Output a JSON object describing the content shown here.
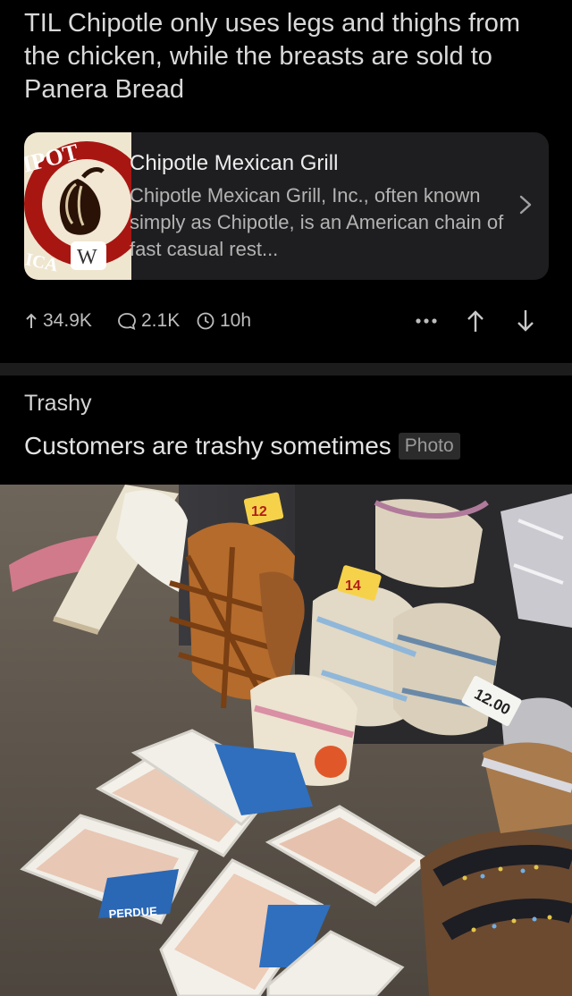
{
  "post1": {
    "title": "TIL Chipotle only uses legs and thighs from the chicken, while the breasts are sold to Panera Bread",
    "link_card": {
      "thumb_text_top": "IPOT",
      "thumb_text_bottom": "ICA",
      "wiki_badge": "W",
      "title": "Chipotle Mexican Grill",
      "description": "Chipotle Mexican Grill, Inc., often known simply as Chipotle, is an American chain of fast casual rest...",
      "chevron_icon": "chevron-right-icon",
      "brand_color": "#a81612"
    },
    "stats": {
      "upvotes": "34.9K",
      "comments": "2.1K",
      "age": "10h"
    }
  },
  "post2": {
    "community": "Trashy",
    "title": "Customers are trashy sometimes",
    "tag": "Photo",
    "photo": {
      "price_tags": [
        "12",
        "14",
        "12.00"
      ],
      "package_brand": "PERDUE"
    }
  },
  "colors": {
    "background": "#000000",
    "card": "#1e1e20",
    "text_primary": "#e6e6e6",
    "text_secondary": "#b3b3b3"
  }
}
